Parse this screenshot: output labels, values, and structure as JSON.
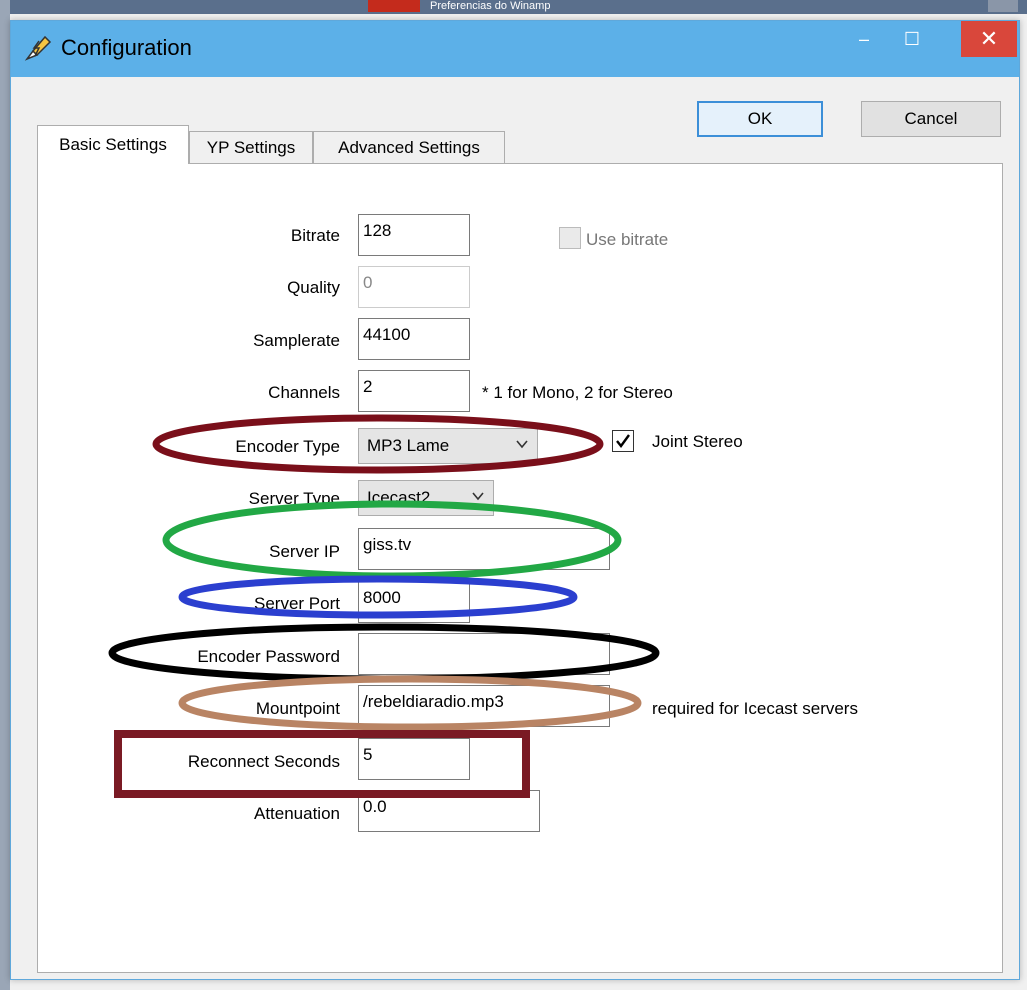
{
  "background": {
    "other_window_title": "Preferencias do Winamp"
  },
  "window": {
    "title": "Configuration",
    "title_icon": "pencil-lightning-icon",
    "controls": {
      "minimize": "–",
      "maximize": "☐",
      "close": "✕"
    }
  },
  "buttons": {
    "ok": "OK",
    "cancel": "Cancel"
  },
  "tabs": [
    {
      "label": "Basic Settings",
      "active": true
    },
    {
      "label": "YP Settings",
      "active": false
    },
    {
      "label": "Advanced Settings",
      "active": false
    }
  ],
  "form": {
    "bitrate": {
      "label": "Bitrate",
      "value": "128"
    },
    "use_bitrate": {
      "label": "Use bitrate",
      "checked": false,
      "enabled": false
    },
    "quality": {
      "label": "Quality",
      "value": "0",
      "enabled": false
    },
    "samplerate": {
      "label": "Samplerate",
      "value": "44100"
    },
    "channels": {
      "label": "Channels",
      "value": "2",
      "hint": "* 1 for Mono, 2 for Stereo"
    },
    "encoder_type": {
      "label": "Encoder Type",
      "value": "MP3 Lame"
    },
    "joint_stereo": {
      "label": "Joint Stereo",
      "checked": true
    },
    "server_type": {
      "label": "Server Type",
      "value": "Icecast2"
    },
    "server_ip": {
      "label": "Server IP",
      "value": "giss.tv"
    },
    "server_port": {
      "label": "Server Port",
      "value": "8000"
    },
    "encoder_password": {
      "label": "Encoder Password",
      "value": ""
    },
    "mountpoint": {
      "label": "Mountpoint",
      "value": "/rebeldiaradio.mp3",
      "hint": "required for Icecast servers"
    },
    "reconnect_seconds": {
      "label": "Reconnect Seconds",
      "value": "5"
    },
    "attenuation": {
      "label": "Attenuation",
      "value": "0.0"
    }
  },
  "annotation_colors": {
    "encoder_type": "#7a0f1a",
    "server_ip": "#22a845",
    "server_port": "#2b3fcf",
    "encoder_password": "#000000",
    "mountpoint": "#b98464",
    "reconnect_seconds": "#7a1a24"
  }
}
